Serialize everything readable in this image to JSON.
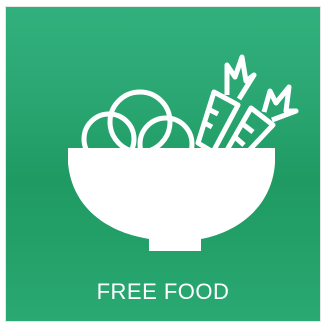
{
  "tile": {
    "label": "FREE FOOD",
    "icon": "food-bowl-icon",
    "background_color": "#24a16b",
    "foreground_color": "#ffffff"
  }
}
